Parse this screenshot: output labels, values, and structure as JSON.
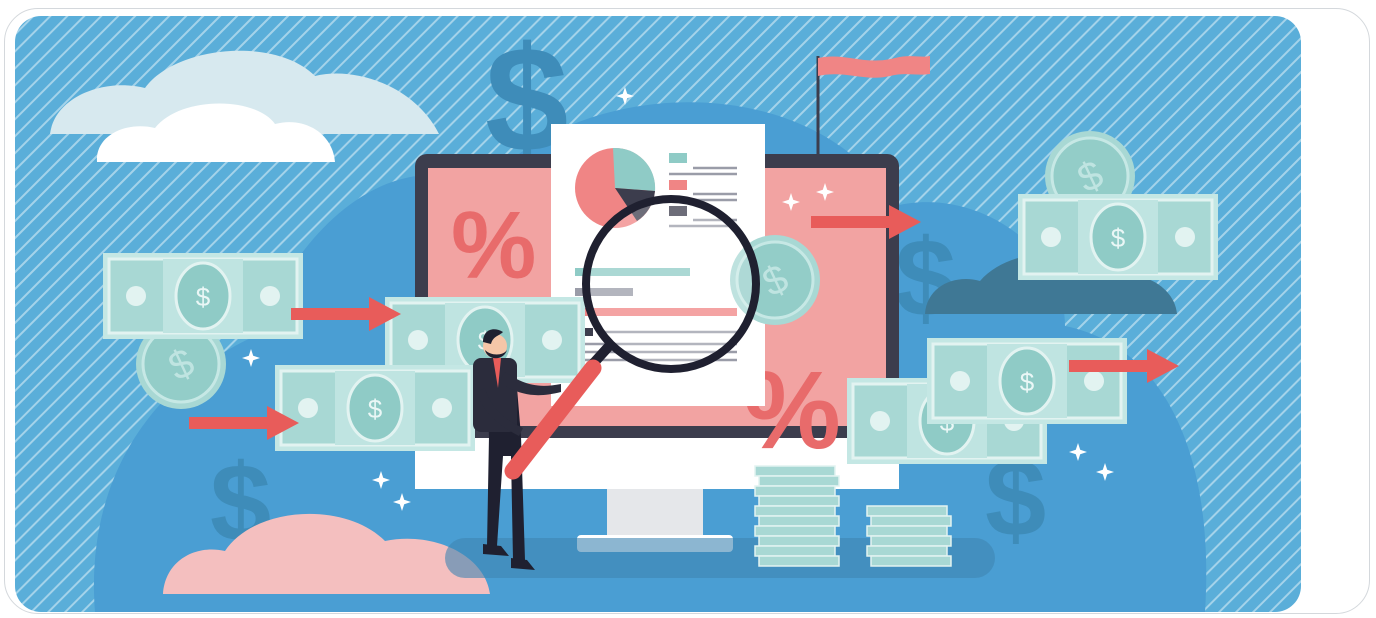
{
  "scene": {
    "subject": "businessman-inspecting-financial-report",
    "glyphs": {
      "percent": "%",
      "dollar": "$"
    },
    "colors": {
      "background": "#5aaed9",
      "stripe": "#bcdff0",
      "hill": "#4a9ed3",
      "monitor_frame": "#3c3d4d",
      "screen": "#f2a3a2",
      "accent_red": "#e85c5a",
      "money_green": "#a8d8d4",
      "cloud_light": "#d7e9ef",
      "cloud_pink": "#f4bfbf",
      "cloud_dark": "#3f7895",
      "dollar_blue": "#3e8cb9"
    }
  }
}
